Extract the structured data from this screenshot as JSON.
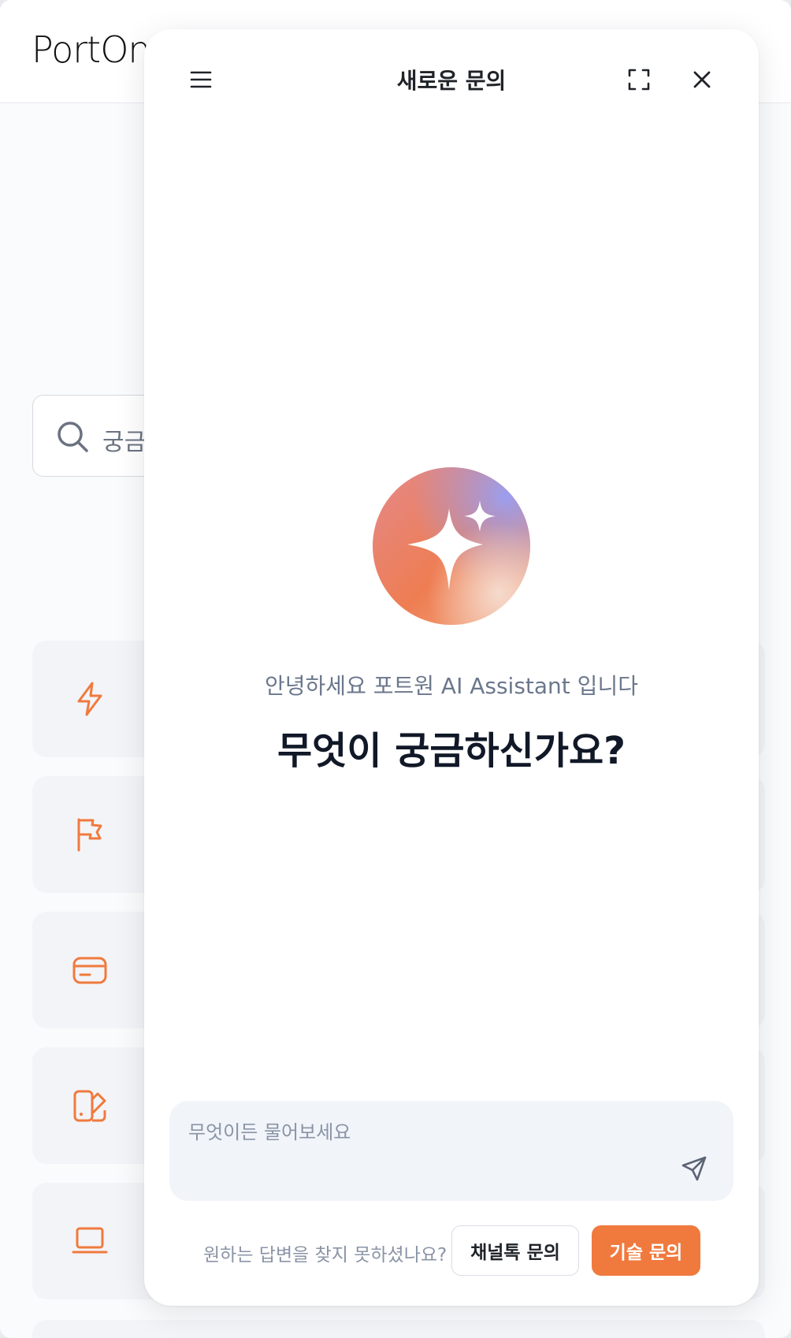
{
  "background_page": {
    "logo_text": "PortOne",
    "search": {
      "placeholder": "궁금"
    },
    "category_icons": [
      "lightning-icon",
      "flag-icon",
      "card-icon",
      "book-icon",
      "laptop-icon"
    ],
    "accent_color": "#f07a3e"
  },
  "chat": {
    "title": "새로운 문의",
    "greeting": "안녕하세요 포트원 AI Assistant 입니다",
    "headline": "무엇이 궁금하신가요?",
    "input": {
      "placeholder": "무엇이든 물어보세요",
      "value": ""
    },
    "footer": {
      "prompt": "원하는 답변을 찾지 못하셨나요?",
      "channel_button": "채널톡 문의",
      "tech_button": "기술 문의"
    },
    "icons": {
      "menu": "menu-icon",
      "expand": "expand-icon",
      "close": "close-icon",
      "send": "send-icon",
      "avatar": "sparkle-icon"
    },
    "colors": {
      "primary": "#f07a3e",
      "input_bg": "#f1f4f9",
      "title": "#1f2328"
    }
  }
}
